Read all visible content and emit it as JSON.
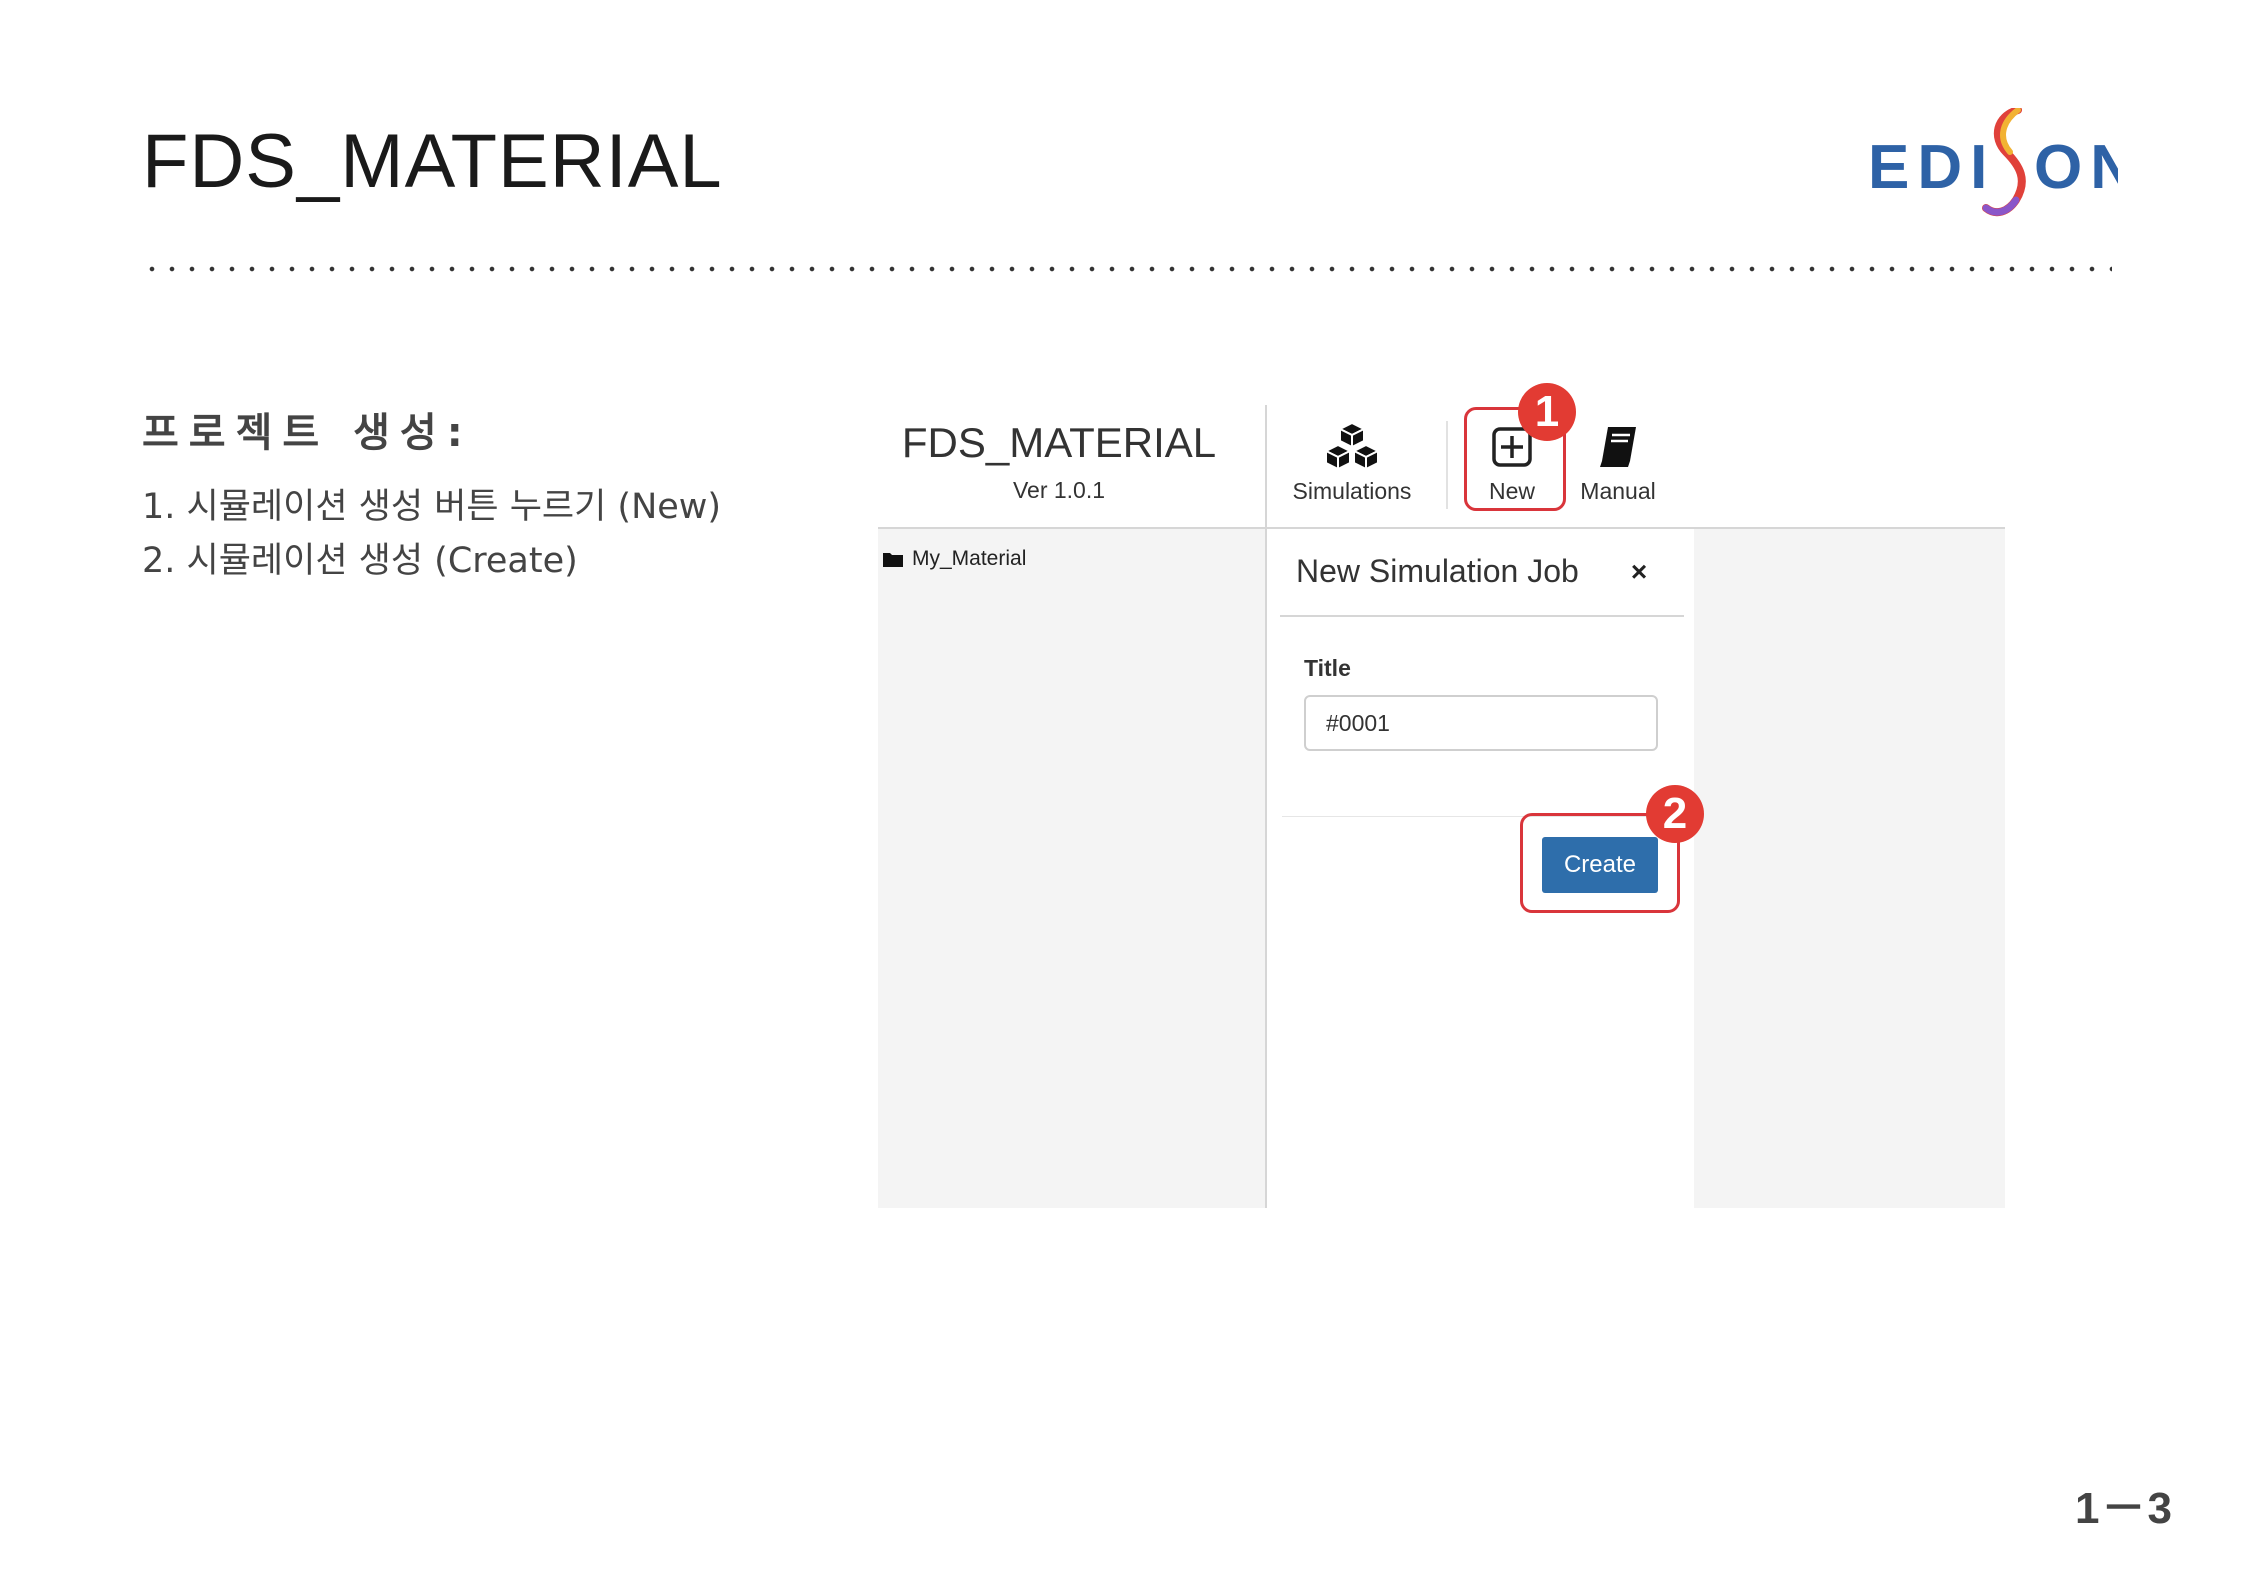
{
  "header": {
    "title": "FDS_MATERIAL",
    "logo_text": "EDISON"
  },
  "content": {
    "section_title": "프로젝트 생성:",
    "steps": [
      "1. 시뮬레이션 생성 버튼 누르기 (New)",
      "2. 시뮬레이션 생성 (Create)"
    ]
  },
  "screenshot": {
    "app_title": "FDS_MATERIAL",
    "app_version": "Ver 1.0.1",
    "toolbar": {
      "simulations_label": "Simulations",
      "new_label": "New",
      "manual_label": "Manual"
    },
    "tree": {
      "items": [
        "My_Material"
      ]
    },
    "dialog": {
      "title": "New Simulation Job",
      "close_label": "×",
      "field_label": "Title",
      "field_value": "#0001",
      "create_label": "Create"
    },
    "callouts": [
      "1",
      "2"
    ]
  },
  "footer": {
    "page_number": "1－3"
  },
  "colors": {
    "logo_blue": "#2e62a6",
    "callout_red": "#e23b33",
    "create_button": "#2e6eab"
  },
  "icons": [
    "cubes-icon",
    "plus-square-icon",
    "book-icon",
    "folder-icon",
    "close-icon"
  ]
}
